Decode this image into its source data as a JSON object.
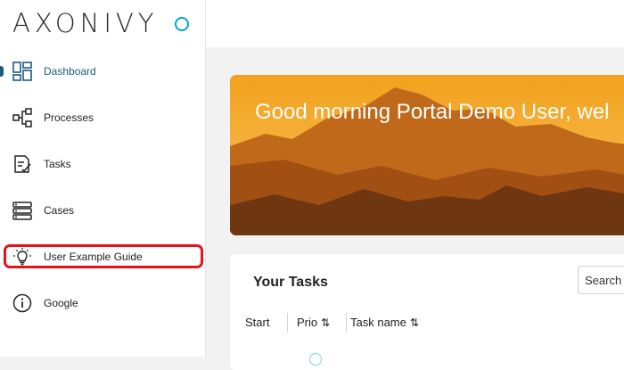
{
  "brand": {
    "name": "AXONIVY",
    "accent": "#00a7c7"
  },
  "sidebar": {
    "items": [
      {
        "label": "Dashboard",
        "icon": "dashboard-icon",
        "active": true
      },
      {
        "label": "Processes",
        "icon": "processes-icon"
      },
      {
        "label": "Tasks",
        "icon": "tasks-icon"
      },
      {
        "label": "Cases",
        "icon": "cases-icon"
      },
      {
        "label": "User Example Guide",
        "icon": "lightbulb-icon",
        "highlighted": true
      },
      {
        "label": "Google",
        "icon": "info-icon"
      }
    ]
  },
  "banner": {
    "greeting": "Good morning Portal Demo User, wel"
  },
  "tasks_widget": {
    "title": "Your Tasks",
    "search_label": "Search",
    "columns": [
      {
        "label": "Start"
      },
      {
        "label": "Prio",
        "sortable": true
      },
      {
        "label": "Task name",
        "sortable": true
      }
    ]
  },
  "colors": {
    "active_nav": "#1a5b80",
    "highlight": "#e3141b"
  }
}
